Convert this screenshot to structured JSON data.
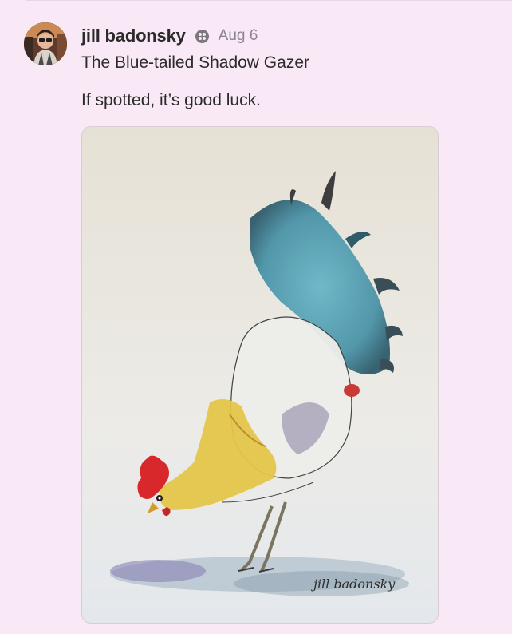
{
  "post": {
    "author": "jill badonsky",
    "date": "Aug 6",
    "title": "The Blue-tailed Shadow Gazer",
    "subtitle": "If spotted, it’s good luck.",
    "signature": "jill badonsky"
  },
  "icons": {
    "badge": "subscriber-badge-icon"
  },
  "colors": {
    "background": "#f9e8f5",
    "date": "#8a8490",
    "text": "#2b2b2b"
  }
}
